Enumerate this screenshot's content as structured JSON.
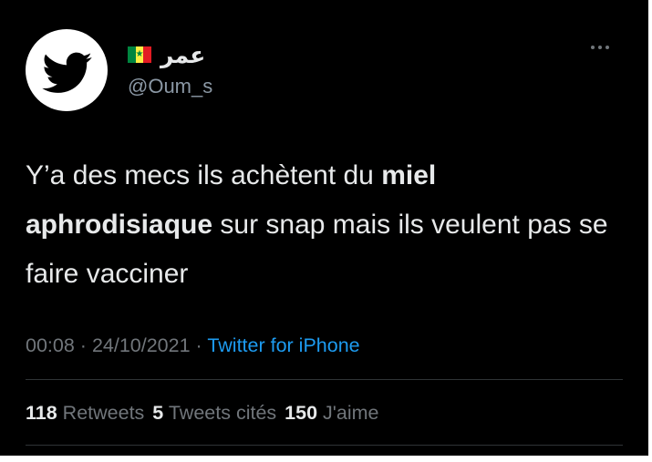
{
  "tweet": {
    "author": {
      "display_name": "عمر",
      "flag": "senegal-flag",
      "handle": "@Oum_s",
      "avatar_icon": "twitter-bird-icon"
    },
    "more_icon": "more-options-icon",
    "text": {
      "part1": "Y’a des mecs ils achètent du ",
      "bold": "miel aphrodisiaque",
      "part2": " sur snap mais ils veulent pas se faire vacciner"
    },
    "time": "00:08",
    "separator": "·",
    "date": "24/10/2021",
    "source": "Twitter for iPhone",
    "stats": {
      "retweets_count": "118",
      "retweets_label": "Retweets",
      "quotes_count": "5",
      "quotes_label": "Tweets cités",
      "likes_count": "150",
      "likes_label": "J'aime"
    }
  },
  "colors": {
    "background": "#000000",
    "primary_text": "#e7e9ea",
    "secondary_text": "#71767b",
    "link": "#1d9bf0",
    "divider": "#2f3336",
    "avatar_bg": "#ffffff"
  }
}
